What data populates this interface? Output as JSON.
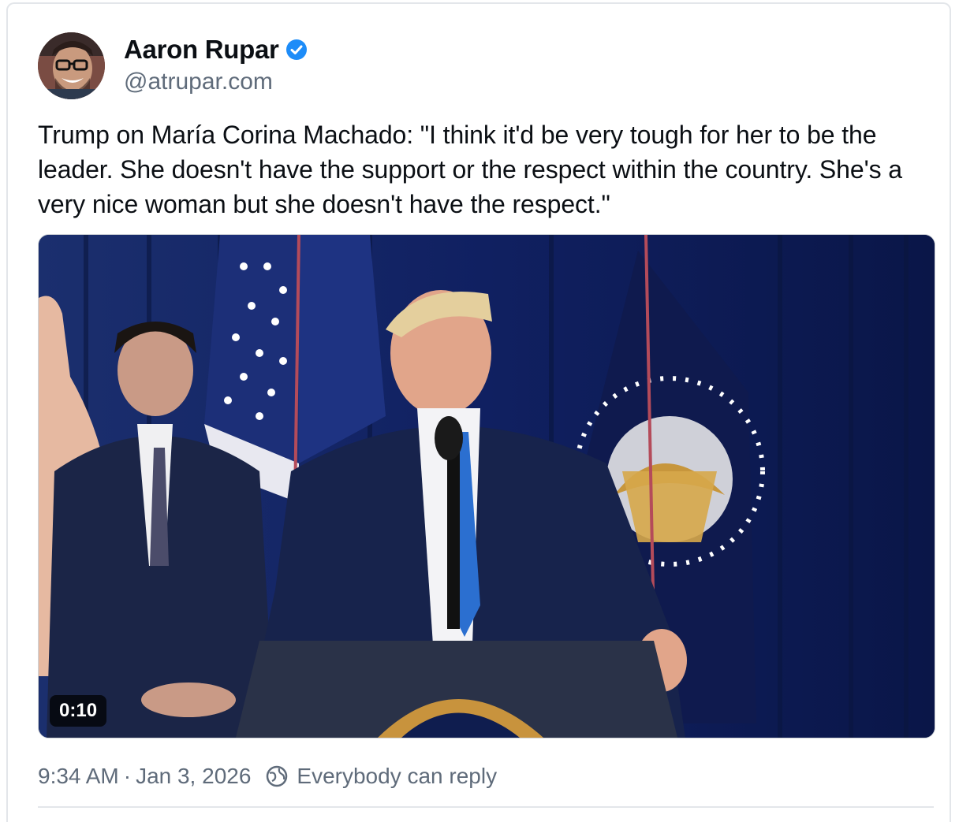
{
  "author": {
    "display_name": "Aaron Rupar",
    "handle": "@atrupar.com",
    "verified": true,
    "avatar_icon": "avatar-photo",
    "verified_icon": "verified-badge-icon",
    "verified_color": "#1d8cf8"
  },
  "post": {
    "text": "Trump on María Corina Machado: \"I think it'd be very tough for her to be the leader. She doesn't have the support or the respect within the country. She's a very nice woman but she doesn't have the respect.\""
  },
  "video": {
    "duration": "0:10",
    "content_icon": "video-thumbnail-press-briefing"
  },
  "meta": {
    "time": "9:34 AM",
    "separator": "·",
    "date": "Jan 3, 2026",
    "reply_setting_icon": "globe-reply-icon",
    "reply_setting": "Everybody can reply"
  },
  "colors": {
    "text_primary": "#0b0f14",
    "text_secondary": "#5f6b7a",
    "border": "#e3e6ea",
    "curtain": "#0e1d52"
  }
}
